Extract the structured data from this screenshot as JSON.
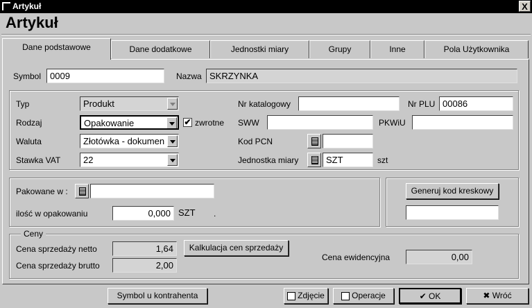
{
  "window": {
    "title": "Artykuł",
    "close": "X",
    "heading": "Artykuł"
  },
  "tabs": [
    "Dane podstawowe",
    "Dane dodatkowe",
    "Jednostki miary",
    "Grupy",
    "Inne",
    "Pola Użytkownika"
  ],
  "form": {
    "symbol_label": "Symbol",
    "symbol": "0009",
    "nazwa_label": "Nazwa",
    "nazwa": "SKRZYNKA",
    "typ_label": "Typ",
    "typ": "Produkt",
    "rodzaj_label": "Rodzaj",
    "rodzaj": "Opakowanie",
    "zwrotne_label": "zwrotne",
    "zwrotne_checked": "✔",
    "waluta_label": "Waluta",
    "waluta": "Złotówka - dokumen",
    "vat_label": "Stawka VAT",
    "vat": "22",
    "nr_kat_label": "Nr katalogowy",
    "nr_kat": "",
    "nr_plu_label": "Nr PLU",
    "nr_plu": "00086",
    "sww_label": "SWW",
    "sww": "",
    "pkwiu_label": "PKWiU",
    "pkwiu": "",
    "kod_pcn_label": "Kod PCN",
    "kod_pcn": "",
    "jm_label": "Jednostka miary",
    "jm": "SZT",
    "jm_unit": "szt",
    "pakowane_label": "Pakowane w :",
    "pakowane": "",
    "ilosc_label": "ilość w opakowaniu",
    "ilosc": "0,000",
    "ilosc_unit": "SZT",
    "ilosc_dot": ".",
    "barcode_button": "Generuj kod kreskowy",
    "barcode": ""
  },
  "ceny": {
    "legend": "Ceny",
    "netto_label": "Cena sprzedaży netto",
    "netto": "1,64",
    "brutto_label": "Cena sprzedaży brutto",
    "brutto": "2,00",
    "kalkulacja_button": "Kalkulacja cen sprzedaży",
    "ewid_label": "Cena ewidencyjna",
    "ewid": "0,00"
  },
  "footer": {
    "symbol_kontrahenta": "Symbol u kontrahenta",
    "zdjecie": "Zdjęcie",
    "operacje": "Operacje",
    "ok": "OK",
    "wroc": "Wróć"
  }
}
